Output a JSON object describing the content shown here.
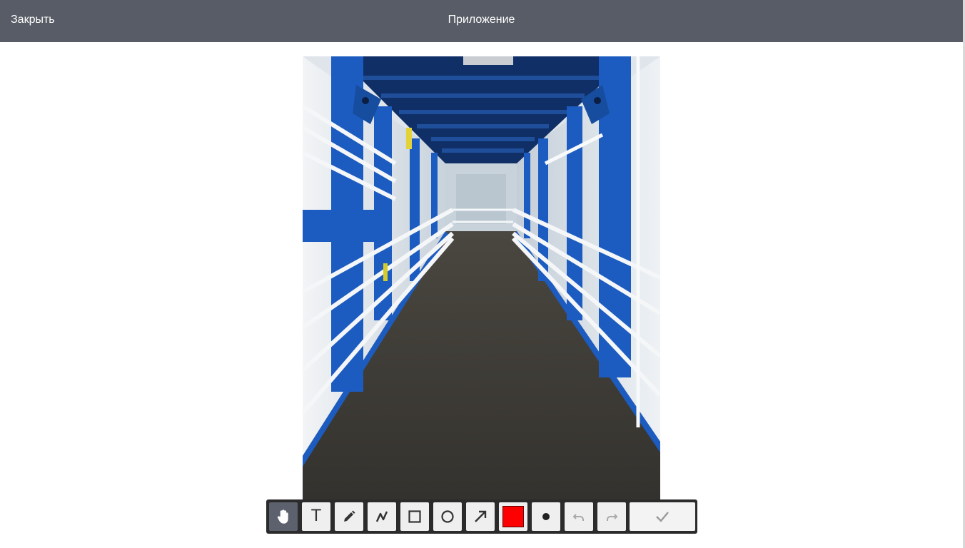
{
  "header": {
    "close_label": "Закрыть",
    "title": "Приложение"
  },
  "photo": {
    "description_icon": "corridor-photo"
  },
  "toolbar": {
    "tools": [
      {
        "name": "hand-tool",
        "icon": "hand-icon",
        "active": true
      },
      {
        "name": "text-tool",
        "icon": "text-icon",
        "glyph": "T"
      },
      {
        "name": "pencil-tool",
        "icon": "pencil-icon"
      },
      {
        "name": "polyline-tool",
        "icon": "polyline-icon"
      },
      {
        "name": "rectangle-tool",
        "icon": "rectangle-icon"
      },
      {
        "name": "circle-tool",
        "icon": "circle-icon"
      },
      {
        "name": "arrow-tool",
        "icon": "arrow-icon"
      },
      {
        "name": "color-picker",
        "icon": "color-swatch",
        "color": "#ff0000"
      },
      {
        "name": "brush-size",
        "icon": "dot-icon"
      },
      {
        "name": "undo",
        "icon": "undo-icon",
        "disabled": true
      },
      {
        "name": "redo",
        "icon": "redo-icon",
        "disabled": true
      },
      {
        "name": "confirm",
        "icon": "check-icon"
      }
    ],
    "accent_color": "#ff0000"
  },
  "colors": {
    "header_bg": "#585c66",
    "active_tool_bg": "#5d616d",
    "toolbar_frame": "#2b2b2b"
  }
}
